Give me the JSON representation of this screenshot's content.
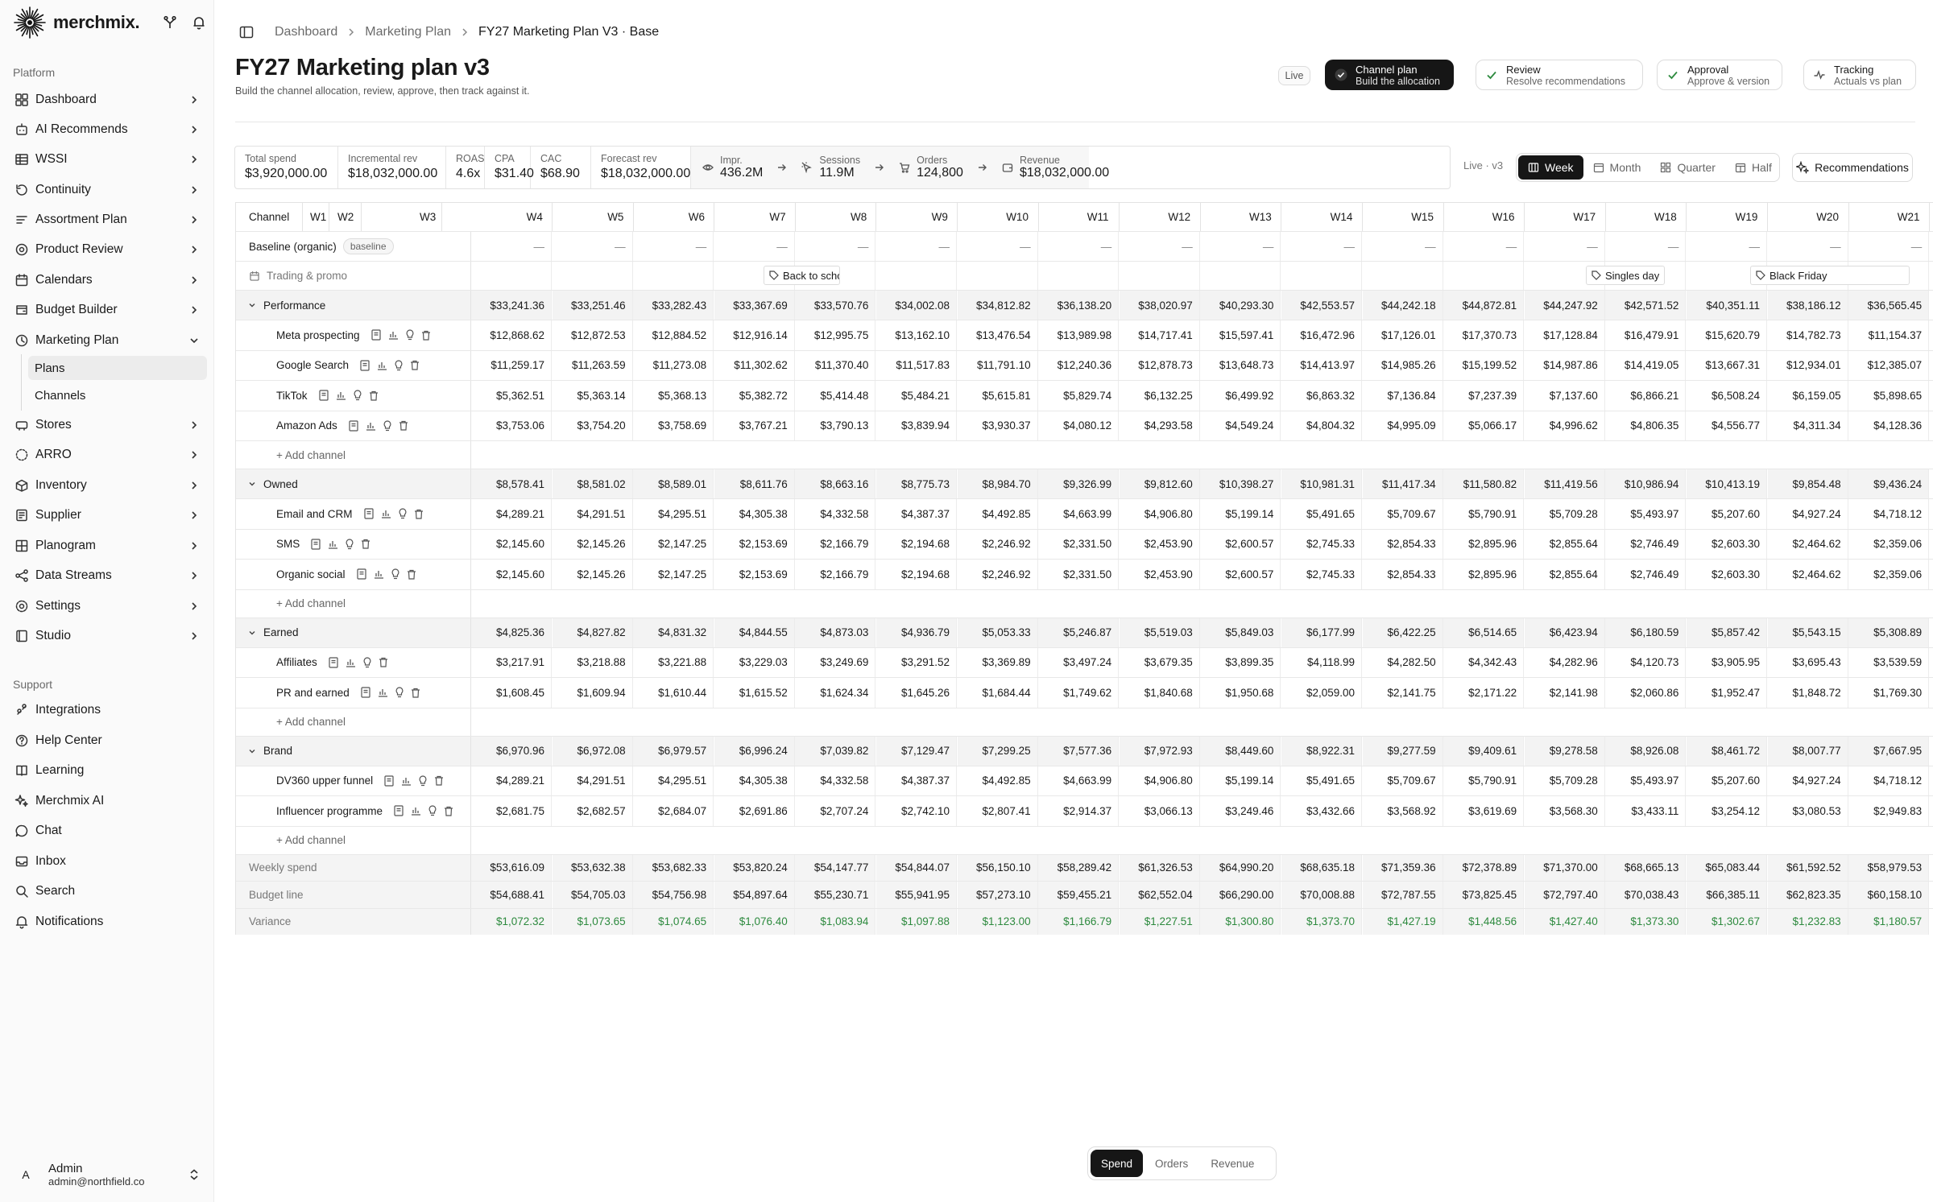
{
  "brand": "merchmix.",
  "sidebar": {
    "section_platform": "Platform",
    "section_support": "Support",
    "items": [
      {
        "label": "Dashboard",
        "icon": "dashboard-icon"
      },
      {
        "label": "AI Recommends",
        "icon": "ai-icon"
      },
      {
        "label": "WSSI",
        "icon": "table-icon"
      },
      {
        "label": "Continuity",
        "icon": "continuity-icon"
      },
      {
        "label": "Assortment Plan",
        "icon": "assortment-icon"
      },
      {
        "label": "Product Review",
        "icon": "review-icon"
      },
      {
        "label": "Calendars",
        "icon": "calendar-icon"
      },
      {
        "label": "Budget Builder",
        "icon": "budget-icon"
      },
      {
        "label": "Marketing Plan",
        "icon": "marketing-icon"
      },
      {
        "label": "Stores",
        "icon": "stores-icon"
      },
      {
        "label": "ARRO",
        "icon": "arro-icon"
      },
      {
        "label": "Inventory",
        "icon": "inventory-icon"
      },
      {
        "label": "Supplier",
        "icon": "supplier-icon"
      },
      {
        "label": "Planogram",
        "icon": "planogram-icon"
      },
      {
        "label": "Data Streams",
        "icon": "share-icon"
      },
      {
        "label": "Settings",
        "icon": "settings-icon"
      },
      {
        "label": "Studio",
        "icon": "studio-icon"
      }
    ],
    "subitems": [
      {
        "label": "Plans"
      },
      {
        "label": "Channels"
      }
    ],
    "support": [
      {
        "label": "Integrations",
        "icon": "integrations-icon"
      },
      {
        "label": "Help Center",
        "icon": "help-icon"
      },
      {
        "label": "Learning",
        "icon": "book-icon"
      },
      {
        "label": "Merchmix AI",
        "icon": "sparkle-icon"
      },
      {
        "label": "Chat",
        "icon": "chat-icon"
      },
      {
        "label": "Inbox",
        "icon": "inbox-icon"
      },
      {
        "label": "Search",
        "icon": "search-icon"
      },
      {
        "label": "Notifications",
        "icon": "bell-icon"
      }
    ],
    "user": {
      "initial": "A",
      "name": "Admin",
      "email": "admin@northfield.co"
    }
  },
  "breadcrumb": [
    "Dashboard",
    "Marketing Plan",
    "FY27 Marketing Plan V3 · Base"
  ],
  "page": {
    "title": "FY27 Marketing plan v3",
    "subtitle": "Build the channel allocation, review, approve, then track against it."
  },
  "live_badge": "Live",
  "steps": [
    {
      "title": "Channel plan",
      "sub": "Build the allocation",
      "active": true
    },
    {
      "title": "Review",
      "sub": "Resolve recommendations",
      "active": false
    },
    {
      "title": "Approval",
      "sub": "Approve & version",
      "active": false
    },
    {
      "title": "Tracking",
      "sub": "Actuals vs plan",
      "active": false
    }
  ],
  "kpis": [
    {
      "label": "Total spend",
      "value": "$3,920,000.00"
    },
    {
      "label": "Incremental rev",
      "value": "$18,032,000.00"
    },
    {
      "label": "ROAS",
      "value": "4.6x"
    },
    {
      "label": "CPA",
      "value": "$31.40"
    },
    {
      "label": "CAC",
      "value": "$68.90"
    },
    {
      "label": "Forecast rev",
      "value": "$18,032,000.00"
    }
  ],
  "funnel": [
    {
      "label": "Impr.",
      "value": "436.2M",
      "icon": "eye-icon"
    },
    {
      "label": "Sessions",
      "value": "11.9M",
      "icon": "cursor-icon"
    },
    {
      "label": "Orders",
      "value": "124,800",
      "icon": "cart-icon"
    },
    {
      "label": "Revenue",
      "value": "$18,032,000.00",
      "icon": "wallet-icon"
    }
  ],
  "version_label": "Live · v3",
  "granularity": {
    "options": [
      "Week",
      "Month",
      "Quarter",
      "Half"
    ],
    "selected": "Week"
  },
  "recommendations_label": "Recommendations",
  "grid": {
    "channel_header": "Channel",
    "weeks": [
      "W1",
      "W2",
      "W3",
      "W4",
      "W5",
      "W6",
      "W7",
      "W8",
      "W9",
      "W10",
      "W11",
      "W12",
      "W13",
      "W14",
      "W15",
      "W16",
      "W17",
      "W18",
      "W19",
      "W20",
      "W21"
    ],
    "baseline": {
      "label": "Baseline (organic)",
      "tag": "baseline",
      "cell": "—"
    },
    "events_row": {
      "label": "Trading & promo",
      "events": [
        {
          "label": "Back to scho"
        },
        {
          "label": "Singles day"
        },
        {
          "label": "Black Friday"
        }
      ]
    },
    "add_channel": "+ Add channel",
    "groups": [
      {
        "name": "Performance",
        "totals": [
          "$33,241.36",
          "$33,251.46",
          "$33,282.43",
          "$33,367.69",
          "$33,570.76",
          "$34,002.08",
          "$34,812.82",
          "$36,138.20",
          "$38,020.97",
          "$40,293.30",
          "$42,553.57",
          "$44,242.18",
          "$44,872.81",
          "$44,247.92",
          "$42,571.52",
          "$40,351.11",
          "$38,186.12",
          "$36,565.45"
        ],
        "channels": [
          {
            "name": "Meta prospecting",
            "values": [
              "$12,868.62",
              "$12,872.53",
              "$12,884.52",
              "$12,916.14",
              "$12,995.75",
              "$13,162.10",
              "$13,476.54",
              "$13,989.98",
              "$14,717.41",
              "$15,597.41",
              "$16,472.96",
              "$17,126.01",
              "$17,370.73",
              "$17,128.84",
              "$16,479.91",
              "$15,620.79",
              "$14,782.73",
              "$11,154.37"
            ]
          },
          {
            "name": "Google Search",
            "values": [
              "$11,259.17",
              "$11,263.59",
              "$11,273.08",
              "$11,302.62",
              "$11,370.40",
              "$11,517.83",
              "$11,791.10",
              "$12,240.36",
              "$12,878.73",
              "$13,648.73",
              "$14,413.97",
              "$14,985.26",
              "$15,199.52",
              "$14,987.86",
              "$14,419.05",
              "$13,667.31",
              "$12,934.01",
              "$12,385.07"
            ]
          },
          {
            "name": "TikTok",
            "values": [
              "$5,362.51",
              "$5,363.14",
              "$5,368.13",
              "$5,382.72",
              "$5,414.48",
              "$5,484.21",
              "$5,615.81",
              "$5,829.74",
              "$6,132.25",
              "$6,499.92",
              "$6,863.32",
              "$7,136.84",
              "$7,237.39",
              "$7,137.60",
              "$6,866.21",
              "$6,508.24",
              "$6,159.05",
              "$5,898.65"
            ]
          },
          {
            "name": "Amazon Ads",
            "values": [
              "$3,753.06",
              "$3,754.20",
              "$3,758.69",
              "$3,767.21",
              "$3,790.13",
              "$3,839.94",
              "$3,930.37",
              "$4,080.12",
              "$4,293.58",
              "$4,549.24",
              "$4,804.32",
              "$4,995.09",
              "$5,066.17",
              "$4,996.62",
              "$4,806.35",
              "$4,556.77",
              "$4,311.34",
              "$4,128.36"
            ]
          }
        ]
      },
      {
        "name": "Owned",
        "totals": [
          "$8,578.41",
          "$8,581.02",
          "$8,589.01",
          "$8,611.76",
          "$8,663.16",
          "$8,775.73",
          "$8,984.70",
          "$9,326.99",
          "$9,812.60",
          "$10,398.27",
          "$10,981.31",
          "$11,417.34",
          "$11,580.82",
          "$11,419.56",
          "$10,986.94",
          "$10,413.19",
          "$9,854.48",
          "$9,436.24"
        ],
        "channels": [
          {
            "name": "Email and CRM",
            "values": [
              "$4,289.21",
              "$4,291.51",
              "$4,295.51",
              "$4,305.38",
              "$4,332.58",
              "$4,387.37",
              "$4,492.85",
              "$4,663.99",
              "$4,906.80",
              "$5,199.14",
              "$5,491.65",
              "$5,709.67",
              "$5,790.91",
              "$5,709.28",
              "$5,493.97",
              "$5,207.60",
              "$4,927.24",
              "$4,718.12"
            ]
          },
          {
            "name": "SMS",
            "values": [
              "$2,145.60",
              "$2,145.26",
              "$2,147.25",
              "$2,153.69",
              "$2,166.79",
              "$2,194.68",
              "$2,246.92",
              "$2,331.50",
              "$2,453.90",
              "$2,600.57",
              "$2,745.33",
              "$2,854.33",
              "$2,895.96",
              "$2,855.64",
              "$2,746.49",
              "$2,603.30",
              "$2,464.62",
              "$2,359.06"
            ]
          },
          {
            "name": "Organic social",
            "values": [
              "$2,145.60",
              "$2,145.26",
              "$2,147.25",
              "$2,153.69",
              "$2,166.79",
              "$2,194.68",
              "$2,246.92",
              "$2,331.50",
              "$2,453.90",
              "$2,600.57",
              "$2,745.33",
              "$2,854.33",
              "$2,895.96",
              "$2,855.64",
              "$2,746.49",
              "$2,603.30",
              "$2,464.62",
              "$2,359.06"
            ]
          }
        ]
      },
      {
        "name": "Earned",
        "totals": [
          "$4,825.36",
          "$4,827.82",
          "$4,831.32",
          "$4,844.55",
          "$4,873.03",
          "$4,936.79",
          "$5,053.33",
          "$5,246.87",
          "$5,519.03",
          "$5,849.03",
          "$6,177.99",
          "$6,422.25",
          "$6,514.65",
          "$6,423.94",
          "$6,180.59",
          "$5,857.42",
          "$5,543.15",
          "$5,308.89"
        ],
        "channels": [
          {
            "name": "Affiliates",
            "values": [
              "$3,217.91",
              "$3,218.88",
              "$3,221.88",
              "$3,229.03",
              "$3,249.69",
              "$3,291.52",
              "$3,369.89",
              "$3,497.24",
              "$3,679.35",
              "$3,899.35",
              "$4,118.99",
              "$4,282.50",
              "$4,342.43",
              "$4,282.96",
              "$4,120.73",
              "$3,905.95",
              "$3,695.43",
              "$3,539.59"
            ]
          },
          {
            "name": "PR and earned",
            "values": [
              "$1,608.45",
              "$1,609.94",
              "$1,610.44",
              "$1,615.52",
              "$1,624.34",
              "$1,645.26",
              "$1,684.44",
              "$1,749.62",
              "$1,840.68",
              "$1,950.68",
              "$2,059.00",
              "$2,141.75",
              "$2,171.22",
              "$2,141.98",
              "$2,060.86",
              "$1,952.47",
              "$1,848.72",
              "$1,769.30"
            ]
          }
        ]
      },
      {
        "name": "Brand",
        "totals": [
          "$6,970.96",
          "$6,972.08",
          "$6,979.57",
          "$6,996.24",
          "$7,039.82",
          "$7,129.47",
          "$7,299.25",
          "$7,577.36",
          "$7,972.93",
          "$8,449.60",
          "$8,922.31",
          "$9,277.59",
          "$9,409.61",
          "$9,278.58",
          "$8,926.08",
          "$8,461.72",
          "$8,007.77",
          "$7,667.95"
        ],
        "channels": [
          {
            "name": "DV360 upper funnel",
            "values": [
              "$4,289.21",
              "$4,291.51",
              "$4,295.51",
              "$4,305.38",
              "$4,332.58",
              "$4,387.37",
              "$4,492.85",
              "$4,663.99",
              "$4,906.80",
              "$5,199.14",
              "$5,491.65",
              "$5,709.67",
              "$5,790.91",
              "$5,709.28",
              "$5,493.97",
              "$5,207.60",
              "$4,927.24",
              "$4,718.12"
            ]
          },
          {
            "name": "Influencer programme",
            "values": [
              "$2,681.75",
              "$2,682.57",
              "$2,684.07",
              "$2,691.86",
              "$2,707.24",
              "$2,742.10",
              "$2,807.41",
              "$2,914.37",
              "$3,066.13",
              "$3,249.46",
              "$3,432.66",
              "$3,568.92",
              "$3,619.69",
              "$3,568.30",
              "$3,433.11",
              "$3,254.12",
              "$3,080.53",
              "$2,949.83"
            ]
          }
        ]
      }
    ],
    "summary": [
      {
        "label": "Weekly spend",
        "values": [
          "$53,616.09",
          "$53,632.38",
          "$53,682.33",
          "$53,820.24",
          "$54,147.77",
          "$54,844.07",
          "$56,150.10",
          "$58,289.42",
          "$61,326.53",
          "$64,990.20",
          "$68,635.18",
          "$71,359.36",
          "$72,378.89",
          "$71,370.00",
          "$68,665.13",
          "$65,083.44",
          "$61,592.52",
          "$58,979.53"
        ]
      },
      {
        "label": "Budget line",
        "values": [
          "$54,688.41",
          "$54,705.03",
          "$54,756.98",
          "$54,897.64",
          "$55,230.71",
          "$55,941.95",
          "$57,273.10",
          "$59,455.21",
          "$62,552.04",
          "$66,290.00",
          "$70,008.88",
          "$72,787.55",
          "$73,825.45",
          "$72,797.40",
          "$70,038.43",
          "$66,385.11",
          "$62,823.35",
          "$60,158.10"
        ]
      },
      {
        "label": "Variance",
        "values": [
          "$1,072.32",
          "$1,073.65",
          "$1,074.65",
          "$1,076.40",
          "$1,083.94",
          "$1,097.88",
          "$1,123.00",
          "$1,166.79",
          "$1,227.51",
          "$1,300.80",
          "$1,373.70",
          "$1,427.19",
          "$1,448.56",
          "$1,427.40",
          "$1,373.30",
          "$1,302.67",
          "$1,232.83",
          "$1,180.57"
        ]
      }
    ]
  },
  "metric_toggle": {
    "options": [
      "Spend",
      "Orders",
      "Revenue"
    ],
    "selected": "Spend"
  },
  "colors": {
    "accent": "#161616",
    "variance": "#2d8a3e",
    "group_bg": "#f3f3f3"
  }
}
